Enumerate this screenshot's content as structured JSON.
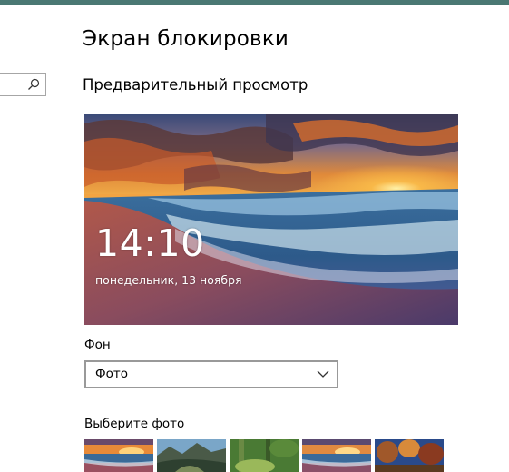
{
  "header": {
    "title": "Экран блокировки"
  },
  "search": {
    "placeholder": ""
  },
  "preview": {
    "heading": "Предварительный просмотр",
    "time": "14:10",
    "date": "понедельник, 13 ноября"
  },
  "background": {
    "label": "Фон",
    "selected": "Фото"
  },
  "photos": {
    "label": "Выберите фото",
    "items": [
      "beach-sunset",
      "mountain-valley",
      "green-forest",
      "beach-sunset-2",
      "autumn-trees"
    ]
  },
  "icons": {
    "search": "search-icon",
    "dropdown": "chevron-down-icon"
  },
  "colors": {
    "accent": "#4a7873",
    "border": "#999999"
  }
}
